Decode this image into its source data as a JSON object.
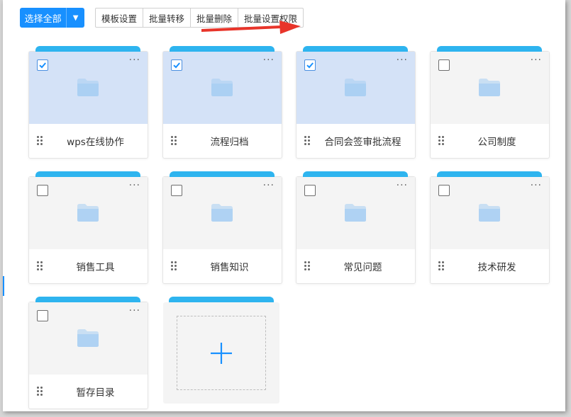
{
  "toolbar": {
    "select_all_label": "选择全部",
    "select_all_caret": "▼",
    "buttons": [
      "模板设置",
      "批量转移",
      "批量删除",
      "批量设置权限"
    ]
  },
  "colors": {
    "accent": "#1890ff",
    "tab": "#2eb4ef",
    "selected_preview": "#d4e2f7",
    "folder": "#a6cdf3",
    "annotation_arrow": "#e8342a"
  },
  "icons": {
    "folder": "folder-icon",
    "more": "more-icon",
    "drag": "drag-handle-icon",
    "check": "check-icon",
    "plus": "plus-icon",
    "caret": "chevron-down-icon"
  },
  "folders": [
    {
      "name": "wps在线协作",
      "selected": true
    },
    {
      "name": "流程归档",
      "selected": true
    },
    {
      "name": "合同会签审批流程",
      "selected": true
    },
    {
      "name": "公司制度",
      "selected": false
    },
    {
      "name": "销售工具",
      "selected": false
    },
    {
      "name": "销售知识",
      "selected": false
    },
    {
      "name": "常见问题",
      "selected": false
    },
    {
      "name": "技术研发",
      "selected": false
    },
    {
      "name": "暂存目录",
      "selected": false
    }
  ],
  "more_glyph": "···"
}
